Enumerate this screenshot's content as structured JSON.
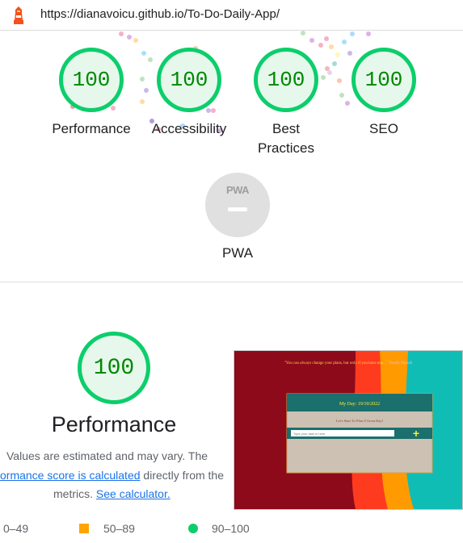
{
  "browser": {
    "url": "https://dianavoicu.github.io/To-Do-Daily-App/"
  },
  "scores": [
    {
      "label": "Performance",
      "score": "100"
    },
    {
      "label": "Accessibility",
      "score": "100"
    },
    {
      "label": "Best Practices",
      "score": "100"
    },
    {
      "label": "SEO",
      "score": "100"
    }
  ],
  "pwa": {
    "badge_text": "PWA",
    "label": "PWA"
  },
  "performance": {
    "score": "100",
    "title": "Performance",
    "desc_line1": "Values are estimated and may vary. The",
    "desc_line2_prefix": "ormance score is calculated",
    "desc_line2_suffix": " directly from the",
    "desc_line3_prefix": "metrics. ",
    "desc_line3_link": "See calculator."
  },
  "screenshot": {
    "quote": "\"You can always change your plans, but only if you have one...\"",
    "quote_author": "Randy Pausch",
    "card_title": "My Day:  19/10/2022",
    "card_subtitle": "Let's Start To Plan A Great Day!",
    "input_placeholder": "Type your task in here",
    "add_symbol": "+"
  },
  "legend": [
    {
      "range": "0–49",
      "color": "#ff4e42"
    },
    {
      "range": "50–89",
      "color": "#ffa400"
    },
    {
      "range": "90–100",
      "color": "#0cce6b"
    }
  ],
  "colors": {
    "pass": "#0cce6b",
    "pass_text": "#008800",
    "pass_bg": "#e6f8ec",
    "link": "#1a73e8"
  }
}
